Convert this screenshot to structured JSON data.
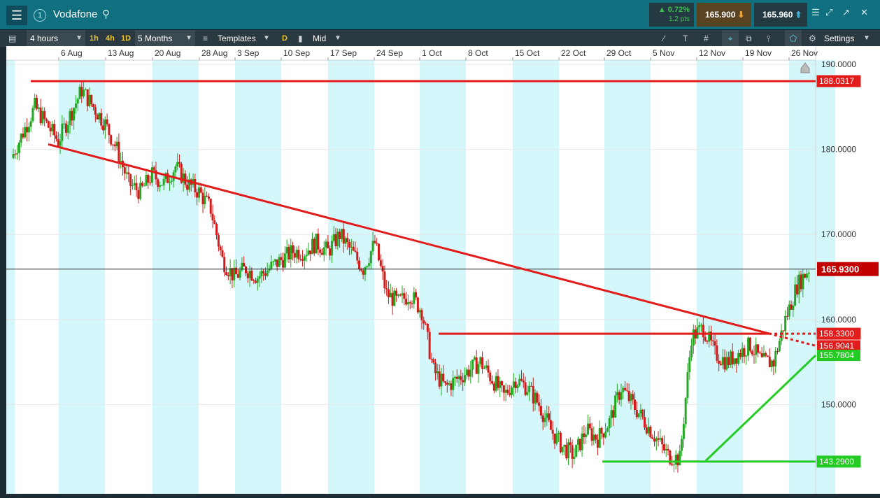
{
  "header": {
    "menu_icon": "hamburger-menu-icon",
    "badge_number": "1",
    "symbol": "Vodafone",
    "search_icon": "search-icon",
    "change_pct": "▲ 0.72%",
    "change_pts": "1.2 pts",
    "sell_price": "165.900",
    "buy_price": "165.960",
    "up_color": "#3ac34a"
  },
  "toolbar": {
    "interval": "4 hours",
    "quick_1h": "1h",
    "quick_4h": "4h",
    "quick_1d": "1D",
    "range": "5 Months",
    "templates": "Templates",
    "price_letter": "D",
    "price_mode": "Mid",
    "settings": "Settings"
  },
  "chart_data": {
    "type": "candlestick",
    "title": "",
    "x_tick_labels": [
      "6 Aug",
      "13 Aug",
      "20 Aug",
      "28 Aug",
      "3 Sep",
      "10 Sep",
      "17 Sep",
      "24 Sep",
      "1 Oct",
      "8 Oct",
      "15 Oct",
      "22 Oct",
      "29 Oct",
      "5 Nov",
      "12 Nov",
      "19 Nov",
      "26 Nov"
    ],
    "y_tick_labels": [
      "190.0000",
      "180.0000",
      "170.0000",
      "160.0000",
      "150.0000"
    ],
    "y_ticks": [
      190,
      180,
      170,
      160,
      150
    ],
    "ylim": [
      139.5,
      190.5
    ],
    "current_price": 165.93,
    "current_price_label": "165.9300",
    "grid": true,
    "up_color": "#22a822",
    "down_color": "#d11a1a",
    "line_red": "#e21b1b",
    "line_green": "#22cc22",
    "horizontal_levels": [
      {
        "value": 188.0317,
        "label": "188.0317",
        "color": "red"
      },
      {
        "value": 158.33,
        "label": "158.3300",
        "color": "red"
      },
      {
        "value": 143.29,
        "label": "143.2900",
        "color": "green"
      }
    ],
    "trendline_labels": [
      {
        "value": 156.9041,
        "label": "156.9041",
        "color": "red",
        "start": {
          "date": "2 Aug",
          "price": 180.6
        }
      },
      {
        "value": 155.7804,
        "label": "155.7804",
        "color": "green",
        "start": {
          "date": "13 Nov",
          "price": 143.4
        }
      }
    ],
    "price_path": [
      [
        0,
        179
      ],
      [
        1,
        182
      ],
      [
        2,
        185
      ],
      [
        3,
        183
      ],
      [
        4,
        181
      ],
      [
        5,
        184
      ],
      [
        6,
        187
      ],
      [
        7,
        185
      ],
      [
        8,
        183
      ],
      [
        9,
        180
      ],
      [
        10,
        176
      ],
      [
        11,
        175
      ],
      [
        12,
        177
      ],
      [
        13,
        176
      ],
      [
        14,
        178
      ],
      [
        15,
        176
      ],
      [
        16,
        175
      ],
      [
        17,
        173
      ],
      [
        18,
        167
      ],
      [
        19,
        165
      ],
      [
        20,
        166
      ],
      [
        21,
        165
      ],
      [
        22,
        166
      ],
      [
        23,
        167
      ],
      [
        24,
        168
      ],
      [
        25,
        168
      ],
      [
        26,
        169
      ],
      [
        27,
        168
      ],
      [
        28,
        170
      ],
      [
        29,
        168
      ],
      [
        30,
        166
      ],
      [
        31,
        169
      ],
      [
        32,
        163
      ],
      [
        33,
        162
      ],
      [
        34,
        163
      ],
      [
        35,
        161
      ],
      [
        36,
        154
      ],
      [
        37,
        152
      ],
      [
        38,
        153
      ],
      [
        39,
        154
      ],
      [
        40,
        155
      ],
      [
        41,
        153
      ],
      [
        42,
        151
      ],
      [
        43,
        153
      ],
      [
        44,
        152
      ],
      [
        45,
        150
      ],
      [
        46,
        147
      ],
      [
        47,
        145
      ],
      [
        48,
        144
      ],
      [
        49,
        147
      ],
      [
        50,
        146
      ],
      [
        51,
        148
      ],
      [
        52,
        152
      ],
      [
        53,
        150
      ],
      [
        54,
        148
      ],
      [
        55,
        146
      ],
      [
        56,
        144
      ],
      [
        57,
        143.6
      ],
      [
        58,
        158
      ],
      [
        59,
        159
      ],
      [
        60,
        156
      ],
      [
        61,
        155
      ],
      [
        62,
        156
      ],
      [
        63,
        157
      ],
      [
        64,
        155
      ],
      [
        65,
        155
      ],
      [
        66,
        160
      ],
      [
        67,
        164
      ],
      [
        68,
        166
      ]
    ]
  }
}
